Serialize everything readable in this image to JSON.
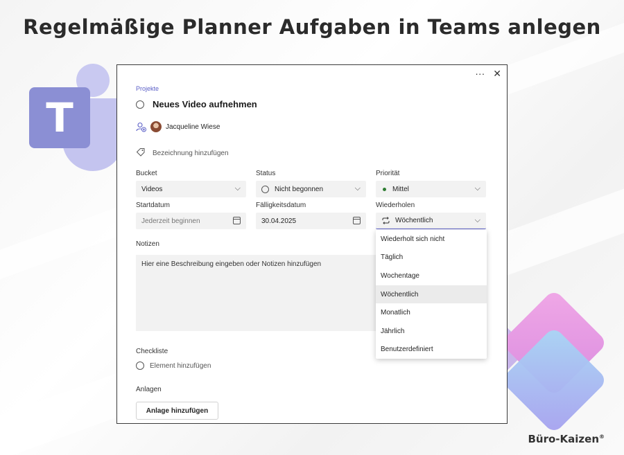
{
  "headline": "Regelmäßige Planner Aufgaben in Teams anlegen",
  "brand": "Büro-Kaizen",
  "brand_mark": "®",
  "teams_logo_letter": "T",
  "dialog": {
    "more_icon": "···",
    "close_icon": "✕",
    "plan_name": "Projekte",
    "task_title": "Neues Video aufnehmen",
    "assignee": "Jacqueline Wiese",
    "add_label": "Bezeichnung hinzufügen",
    "bucket": {
      "label": "Bucket",
      "value": "Videos"
    },
    "status": {
      "label": "Status",
      "value": "Nicht begonnen"
    },
    "priority": {
      "label": "Priorität",
      "value": "Mittel",
      "dot_color": "#2e7d32"
    },
    "start_date": {
      "label": "Startdatum",
      "placeholder": "Jederzeit beginnen"
    },
    "due_date": {
      "label": "Fälligkeitsdatum",
      "value": "30.04.2025"
    },
    "repeat": {
      "label": "Wiederholen",
      "value": "Wöchentlich",
      "options": [
        "Wiederholt sich nicht",
        "Täglich",
        "Wochentage",
        "Wöchentlich",
        "Monatlich",
        "Jährlich",
        "Benutzerdefiniert"
      ],
      "selected_index": 3
    },
    "notes": {
      "label": "Notizen",
      "placeholder": "Hier eine Beschreibung eingeben oder Notizen hinzufügen"
    },
    "checklist": {
      "label": "Checkliste",
      "add_item": "Element hinzufügen"
    },
    "attachments": {
      "label": "Anlagen",
      "button": "Anlage hinzufügen"
    }
  },
  "colors": {
    "accent": "#5b5fc7",
    "teams_purple": "#8b8fd4"
  }
}
